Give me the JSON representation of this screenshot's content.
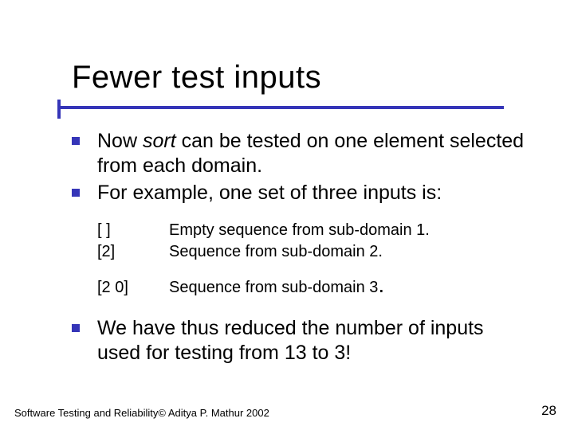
{
  "title": "Fewer test inputs",
  "bullets": {
    "b1_pre": "Now ",
    "b1_italic": "sort",
    "b1_post": " can be tested on one element selected from each domain.",
    "b2": "For example, one set of three inputs is:",
    "b3": "We have thus reduced the number of inputs used for testing from 13 to 3!"
  },
  "examples": {
    "r1_key": "[ ]",
    "r1_val": "Empty sequence from sub-domain 1.",
    "r2_key": "[2]",
    "r2_val": "Sequence from sub-domain 2.",
    "r3_key": "[2 0]",
    "r3_val_pre": "Sequence from sub-domain 3",
    "r3_dot": "."
  },
  "footer": "Software Testing and Reliability© Aditya P. Mathur 2002",
  "page": "28"
}
